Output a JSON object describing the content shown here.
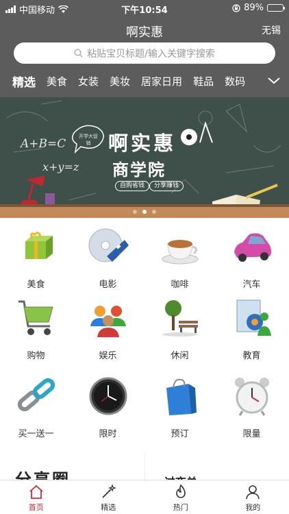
{
  "status_bar": {
    "carrier": "中国移动",
    "time": "下午10:54",
    "battery_text": "89%",
    "battery_level": 0.89
  },
  "header": {
    "title": "啊实惠",
    "city": "无锡",
    "search_placeholder": "粘贴宝贝标题/输入关键字搜索"
  },
  "categories": [
    "精选",
    "美食",
    "女装",
    "美妆",
    "居家日用",
    "鞋品",
    "数码"
  ],
  "banner": {
    "title": "啊实惠",
    "subtitle": "商学院",
    "tag_left": "自购省钱",
    "tag_right": "分享赚钱",
    "chalk_a": "A+B=C",
    "chalk_b": "x+y=z",
    "bubble": "开学大促销",
    "slide_count": 3,
    "active_slide": 2
  },
  "grid": [
    {
      "label": "美食",
      "icon": "gift-box-icon"
    },
    {
      "label": "电影",
      "icon": "film-disc-icon"
    },
    {
      "label": "咖啡",
      "icon": "coffee-cup-icon"
    },
    {
      "label": "汽车",
      "icon": "car-icon"
    },
    {
      "label": "购物",
      "icon": "shopping-cart-icon"
    },
    {
      "label": "娱乐",
      "icon": "people-group-icon"
    },
    {
      "label": "休闲",
      "icon": "park-bench-icon"
    },
    {
      "label": "教育",
      "icon": "education-icon"
    },
    {
      "label": "买一送一",
      "icon": "chain-link-icon"
    },
    {
      "label": "限时",
      "icon": "clock-icon"
    },
    {
      "label": "预订",
      "icon": "shopping-bag-icon"
    },
    {
      "label": "限量",
      "icon": "alarm-clock-icon"
    }
  ],
  "cards": {
    "left_title": "分享圈",
    "right_title": "过夜单"
  },
  "tabbar": [
    {
      "label": "首页",
      "icon": "home-icon",
      "active": true
    },
    {
      "label": "精选",
      "icon": "magic-wand-icon",
      "active": false
    },
    {
      "label": "热门",
      "icon": "flame-icon",
      "active": false
    },
    {
      "label": "我的",
      "icon": "user-icon",
      "active": false
    }
  ],
  "colors": {
    "header_bg": "#5c5c5c",
    "accent": "#d9253a",
    "banner_bg": "#3f4f49"
  }
}
